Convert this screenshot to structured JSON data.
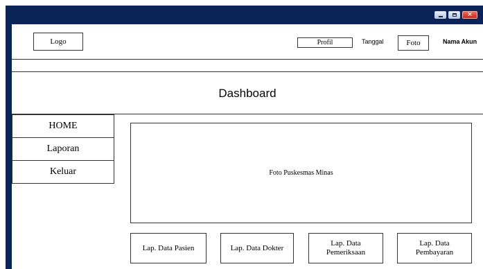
{
  "window": {
    "controls": {
      "minimize_icon": "minimize-icon",
      "maximize_icon": "maximize-icon",
      "close_icon": "close-icon",
      "close_glyph": "×"
    },
    "colors": {
      "frame": "#0a2458",
      "close_button": "#c7281a"
    }
  },
  "header": {
    "logo": "Logo",
    "profil": "Profil",
    "tanggal": "Tanggal",
    "foto": "Foto",
    "nama_akun": "Nama Akun"
  },
  "page": {
    "title": "Dashboard"
  },
  "sidebar": {
    "items": [
      {
        "label": "HOME"
      },
      {
        "label": "Laporan"
      },
      {
        "label": "Keluar"
      }
    ]
  },
  "main": {
    "photo_placeholder": "Foto Puskesmas Minas",
    "report_buttons": [
      {
        "label": "Lap. Data Pasien"
      },
      {
        "label": "Lap. Data Dokter"
      },
      {
        "label": "Lap. Data\nPemeriksaan"
      },
      {
        "label": "Lap. Data\nPembayaran"
      }
    ]
  }
}
